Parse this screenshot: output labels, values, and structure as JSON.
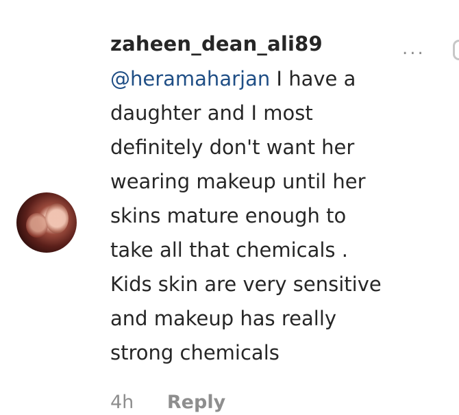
{
  "comment": {
    "username": "zaheen_dean_ali89",
    "more_label": "...",
    "mention": "@heramaharjan",
    "lines": [
      " I have a",
      "daughter and I most",
      "definitely don't want her",
      "wearing makeup until her",
      "skins mature enough to",
      "take all that chemicals .",
      "Kids skin are very sensitive",
      "and makeup has really",
      "strong chemicals"
    ],
    "time": "4h",
    "reply_label": "Reply"
  },
  "colors": {
    "text": "#262626",
    "mention": "#1f4e85",
    "muted": "#8e8e8e"
  },
  "icons": {
    "more": "more-options-icon",
    "avatar": "avatar"
  }
}
